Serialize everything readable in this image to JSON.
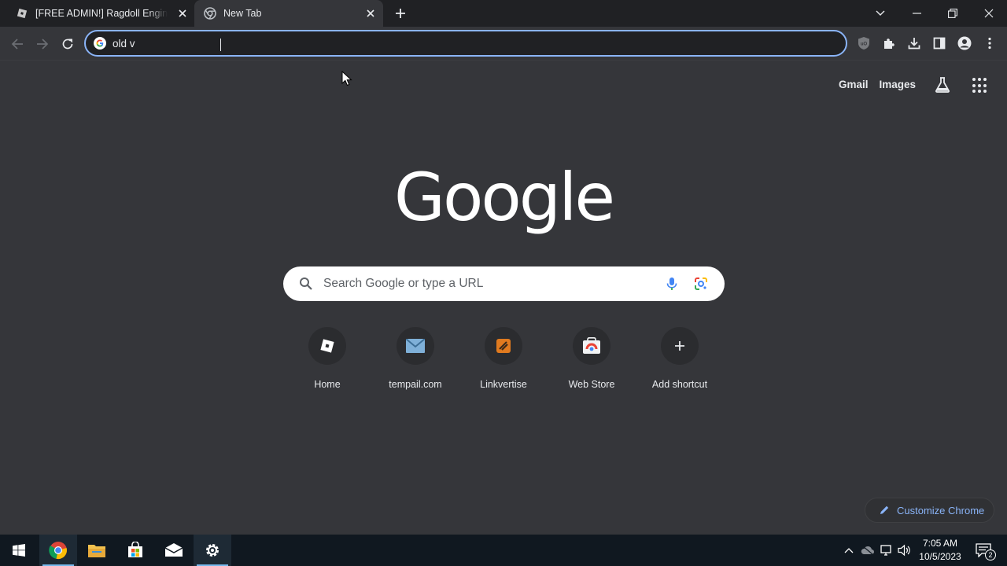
{
  "tabs": [
    {
      "title": "[FREE ADMIN!] Ragdoll Engine - Roblox",
      "active": false
    },
    {
      "title": "New Tab",
      "active": true
    }
  ],
  "omnibox": {
    "value": "old v"
  },
  "toplinks": {
    "gmail": "Gmail",
    "images": "Images"
  },
  "logo": {
    "text": "Google"
  },
  "search": {
    "placeholder": "Search Google or type a URL"
  },
  "shortcuts": [
    {
      "label": "Home",
      "icon": "roblox-icon"
    },
    {
      "label": "tempail.com",
      "icon": "mail-icon"
    },
    {
      "label": "Linkvertise",
      "icon": "linkvertise-icon"
    },
    {
      "label": "Web Store",
      "icon": "chrome-web-store-icon"
    },
    {
      "label": "Add shortcut",
      "icon": "plus-icon"
    }
  ],
  "customize": {
    "label": "Customize Chrome"
  },
  "taskbar": {
    "clock_time": "7:05 AM",
    "clock_date": "10/5/2023",
    "notification_count": "2"
  },
  "colors": {
    "background": "#35363a",
    "tabstrip": "#202124",
    "accent": "#8ab4f8",
    "taskbar": "#101820"
  }
}
